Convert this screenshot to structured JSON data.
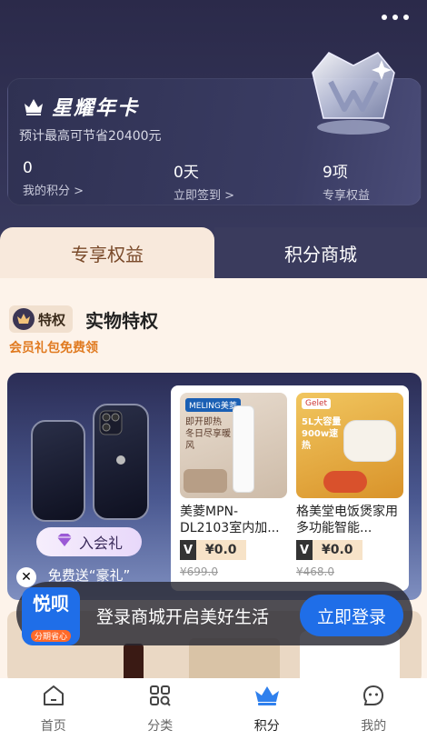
{
  "header": {
    "card_title": "星耀年卡",
    "card_subtitle": "预计最高可节省20400元",
    "stats": [
      {
        "value": "0",
        "label": "我的积分 >"
      },
      {
        "value": "0天",
        "label": "立即签到 >"
      },
      {
        "value": "9项",
        "label": "专享权益"
      }
    ]
  },
  "tabs": [
    {
      "label": "专享权益",
      "active": true
    },
    {
      "label": "积分商城",
      "active": false
    }
  ],
  "section": {
    "badge": "特权",
    "title": "实物特权",
    "subtitle": "会员礼包免费领"
  },
  "promo": {
    "join_label": "入会礼",
    "free_gift": "免费送“豪礼”",
    "products": [
      {
        "brand_tag": "MELING美菱",
        "img_text": "即开即热 冬日尽享暖风",
        "name": "美菱MPN-DL2103室内加...",
        "price": "¥0.0",
        "original_price": "¥699.0"
      },
      {
        "brand_tag": "Gelet",
        "img_text": "5L大容量 900w速热",
        "name": "格美堂电饭煲家用多功能智能...",
        "price": "¥0.0",
        "original_price": "¥468.0"
      }
    ]
  },
  "login_bar": {
    "app_name": "悦呗",
    "app_slogan": "分期省心",
    "text": "登录商城开启美好生活",
    "button": "立即登录"
  },
  "tabbar": [
    {
      "label": "首页",
      "icon": "home-icon",
      "active": false
    },
    {
      "label": "分类",
      "icon": "category-icon",
      "active": false
    },
    {
      "label": "积分",
      "icon": "crown-icon",
      "active": true
    },
    {
      "label": "我的",
      "icon": "profile-icon",
      "active": false
    }
  ],
  "colors": {
    "accent": "#1f6ee8",
    "header_bg": "#2b2a4a",
    "tab_active_bg": "#f8e9dc",
    "highlight_orange": "#e07a20"
  }
}
